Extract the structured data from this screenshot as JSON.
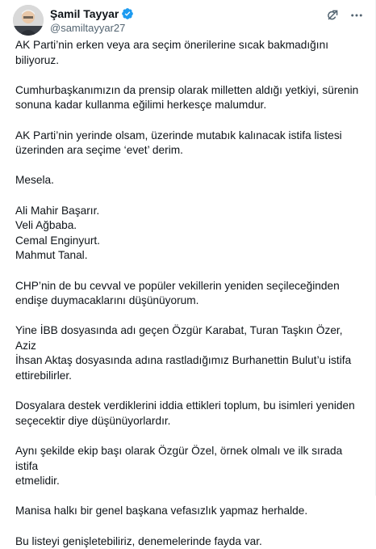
{
  "author": {
    "name": "Şamil Tayyar",
    "handle": "@samiltayyar27",
    "verified": true,
    "verified_color": "#1d9bf0"
  },
  "icons": {
    "grok": "grok-icon",
    "more": "more-options-icon",
    "verified": "verified-badge-icon"
  },
  "tweet": {
    "paragraphs": [
      [
        "AK Parti’nin erken veya ara seçim önerilerine sıcak bakmadığını biliyoruz."
      ],
      [
        "Cumhurbaşkanımızın da prensip olarak milletten aldığı yetkiyi, sürenin",
        "sonuna kadar kullanma eğilimi herkesçe malumdur."
      ],
      [
        "AK Parti’nin yerinde olsam, üzerinde mutabık kalınacak istifa listesi",
        "üzerinden ara seçime ‘evet’ derim."
      ],
      [
        "Mesela."
      ],
      [
        "Ali Mahir Başarır.",
        "Veli Ağbaba.",
        "Cemal Enginyurt.",
        "Mahmut Tanal."
      ],
      [
        "CHP’nin de bu cevval ve popüler vekillerin yeniden seçileceğinden",
        "endişe duymacaklarını düşünüyorum."
      ],
      [
        "Yine İBB dosyasında adı geçen Özgür Karabat, Turan Taşkın Özer, Aziz",
        "İhsan Aktaş dosyasında adına rastladığımız Burhanettin Bulut’u istifa",
        "ettirebilirler."
      ],
      [
        "Dosyalara destek verdiklerini iddia ettikleri toplum, bu isimleri yeniden",
        "seçecektir diye düşünüyorlardır."
      ],
      [
        "Aynı şekilde ekip başı olarak Özgür Özel, örnek olmalı ve ilk sırada istifa",
        "etmelidir."
      ],
      [
        "Manisa halkı bir genel başkana vefasızlık yapmaz herhalde."
      ],
      [
        "Bu listeyi genişletebiliriz, denemelerinde fayda var."
      ]
    ]
  }
}
